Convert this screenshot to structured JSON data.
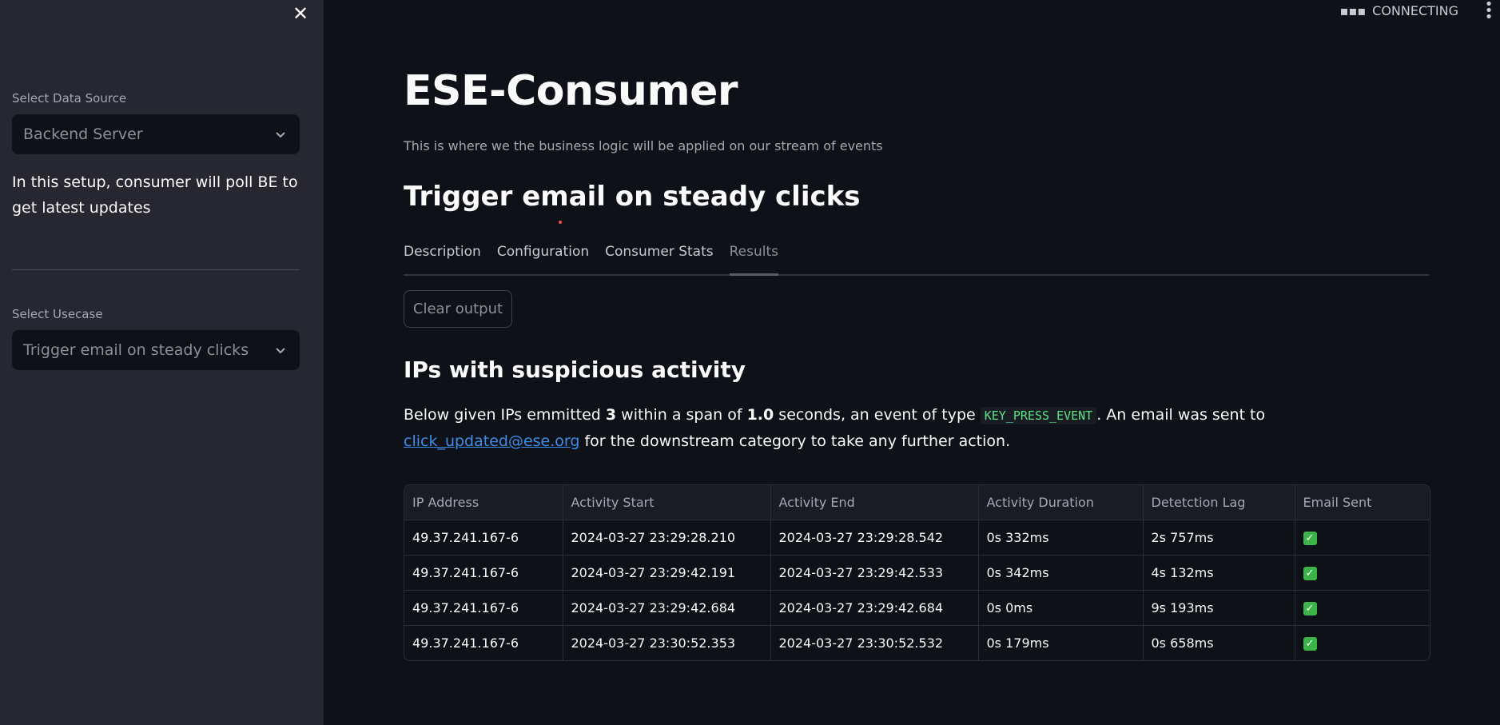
{
  "sidebar": {
    "data_source_label": "Select Data Source",
    "data_source_value": "Backend Server",
    "note": "In this setup, consumer will poll BE to get latest updates",
    "usecase_label": "Select Usecase",
    "usecase_value": "Trigger email on steady clicks"
  },
  "header": {
    "status_text": "CONNECTING"
  },
  "main": {
    "title": "ESE-Consumer",
    "subtitle": "This is where we the business logic will be applied on our stream of events",
    "usecase_heading": "Trigger email on steady clicks",
    "tabs": [
      {
        "label": "Description"
      },
      {
        "label": "Configuration"
      },
      {
        "label": "Consumer Stats"
      },
      {
        "label": "Results"
      }
    ],
    "active_tab": "Results",
    "clear_button": "Clear output",
    "section_heading": "IPs with suspicious activity",
    "paragraph": {
      "part1": "Below given IPs emmitted ",
      "count": "3",
      "part2": " within a span of ",
      "seconds": "1.0",
      "part3": " seconds, an event of type ",
      "event_type": "KEY_PRESS_EVENT",
      "part4": ". An email was sent to ",
      "email": "click_updated@ese.org",
      "part5": " for the downstream category to take any further action."
    },
    "table": {
      "columns": [
        "IP Address",
        "Activity Start",
        "Activity End",
        "Activity Duration",
        "Detetction Lag",
        "Email Sent"
      ],
      "rows": [
        [
          "49.37.241.167-6",
          "2024-03-27 23:29:28.210",
          "2024-03-27 23:29:28.542",
          "0s 332ms",
          "2s 757ms",
          true
        ],
        [
          "49.37.241.167-6",
          "2024-03-27 23:29:42.191",
          "2024-03-27 23:29:42.533",
          "0s 342ms",
          "4s 132ms",
          true
        ],
        [
          "49.37.241.167-6",
          "2024-03-27 23:29:42.684",
          "2024-03-27 23:29:42.684",
          "0s 0ms",
          "9s 193ms",
          true
        ],
        [
          "49.37.241.167-6",
          "2024-03-27 23:30:52.353",
          "2024-03-27 23:30:52.532",
          "0s 179ms",
          "0s 658ms",
          true
        ]
      ]
    }
  },
  "colors": {
    "background": "#0e1117",
    "sidebar": "#262730",
    "link": "#3b8eea",
    "code": "#5ce488",
    "check": "#3bb54a"
  }
}
